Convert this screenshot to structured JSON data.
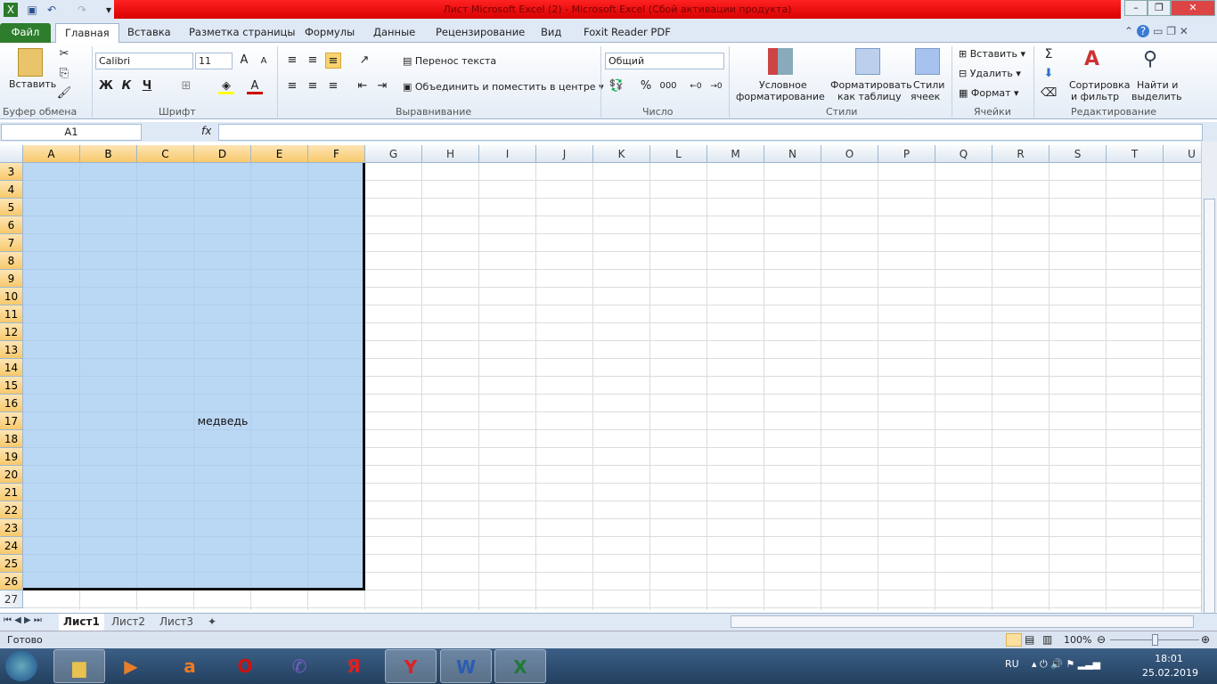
{
  "title": "Лист Microsoft Excel (2)  -  Microsoft Excel (Сбой активации продукта)",
  "tabs": [
    "Файл",
    "Главная",
    "Вставка",
    "Разметка страницы",
    "Формулы",
    "Данные",
    "Рецензирование",
    "Вид",
    "Foxit Reader PDF"
  ],
  "ribbon": {
    "paste": "Вставить",
    "clipboard": "Буфер обмена",
    "font_name": "Calibri",
    "font_size": "11",
    "font": "Шрифт",
    "bold": "Ж",
    "italic": "К",
    "underline": "Ч",
    "wrap": "Перенос текста",
    "merge": "Объединить и поместить в центре",
    "alignment": "Выравнивание",
    "number_format": "Общий",
    "percent": "%",
    "thousands": "000",
    "number": "Число",
    "cond1": "Условное",
    "cond2": "форматирование",
    "fmt1": "Форматировать",
    "fmt2": "как таблицу",
    "st1": "Стили",
    "st2": "ячеек",
    "styles": "Стили",
    "insert": "Вставить",
    "delete": "Удалить",
    "format": "Формат",
    "cells": "Ячейки",
    "sum": "Σ",
    "sort1": "Сортировка",
    "sort2": "и фильтр",
    "find1": "Найти и",
    "find2": "выделить",
    "editing": "Редактирование"
  },
  "formula": {
    "namebox": "A1",
    "fx": "fx",
    "value": ""
  },
  "columns": [
    "A",
    "B",
    "C",
    "D",
    "E",
    "F",
    "G",
    "H",
    "I",
    "J",
    "K",
    "L",
    "M",
    "N",
    "O",
    "P",
    "Q",
    "R",
    "S",
    "T",
    "U"
  ],
  "selected_columns": [
    "A",
    "B",
    "C",
    "D",
    "E",
    "F"
  ],
  "rows": [
    3,
    4,
    5,
    6,
    7,
    8,
    9,
    10,
    11,
    12,
    13,
    14,
    15,
    16,
    17,
    18,
    19,
    20,
    21,
    22,
    23,
    24,
    25,
    26,
    27
  ],
  "selected_rows": [
    3,
    26
  ],
  "cell_text": "медведь",
  "sheets": [
    "Лист1",
    "Лист2",
    "Лист3"
  ],
  "status": {
    "ready": "Готово",
    "zoom": "100%",
    "zoom_fraction": 0.5
  },
  "tray": {
    "lang": "RU",
    "time": "18:01",
    "date": "25.02.2019"
  },
  "taskbar": [
    "explorer",
    "media-player",
    "avast",
    "opera",
    "viber",
    "yandex",
    "yandex-browser",
    "word",
    "excel"
  ]
}
